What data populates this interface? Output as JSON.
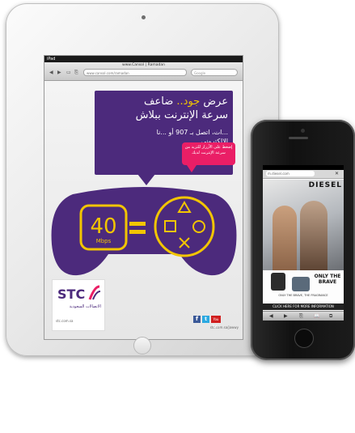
{
  "tablet": {
    "status_carrier": "iPad",
    "browser_title": "www.Cansol | Ramadan",
    "url": "www.cansol.com/ramadan",
    "search_placeholder": "Google",
    "nav_back": "◀",
    "nav_forward": "▶",
    "nav_bookmarks": "▭",
    "nav_share": "⎘",
    "ad": {
      "headline_line1_accent": "جود..",
      "headline_line1_rest": "عرض",
      "headline_line1_end": "ضاعف",
      "headline_line2": "سرعة الإنترنت ببلاش",
      "subline": "...ات، اتصل بـ 907 أو ...نا الإلكتروني.",
      "small_bubble_text": "إضغط على الأزرار للتزيد من سرعة الإنترنت لديك",
      "speed_value": "40",
      "speed_unit": "Mbps",
      "equals": "=",
      "brand": "STC",
      "brand_tagline": "الاتصالات السعودية",
      "brand_site": "stc.com.sa",
      "ad_url": "stc.com.sa/jawwy",
      "social_fb": "f",
      "social_tw": "t",
      "social_yt": "You Tube"
    }
  },
  "phone": {
    "url": "m.diesel.com",
    "close": "✕",
    "brand": "DIESEL",
    "tagline": "ONLY THE BRAVE",
    "caption": "ONLY THE BRAVE, THE FRAGRANCE",
    "cta": "CLICK HERE FOR MORE INFORMATION",
    "toolbar_back": "◀",
    "toolbar_forward": "▶",
    "toolbar_share": "⎘",
    "toolbar_bookmarks": "📖",
    "toolbar_tabs": "⧉"
  },
  "colors": {
    "purple": "#4c2a7c",
    "yellow": "#f2c500",
    "pink": "#ea1e66"
  }
}
